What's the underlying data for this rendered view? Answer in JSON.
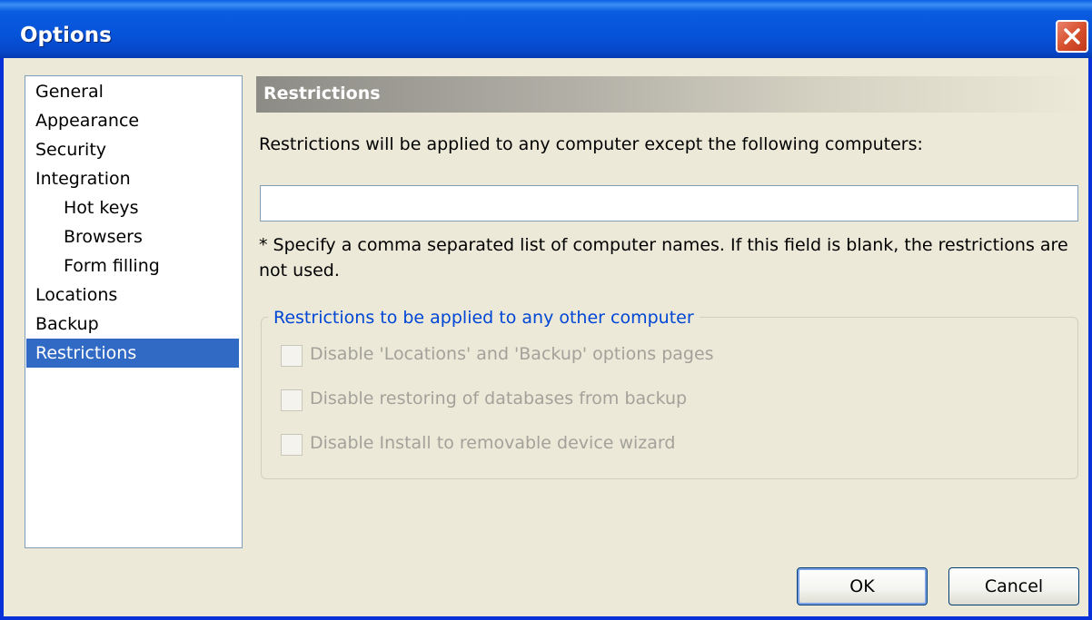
{
  "window": {
    "title": "Options"
  },
  "nav": {
    "items": [
      {
        "label": "General",
        "sub": false,
        "selected": false
      },
      {
        "label": "Appearance",
        "sub": false,
        "selected": false
      },
      {
        "label": "Security",
        "sub": false,
        "selected": false
      },
      {
        "label": "Integration",
        "sub": false,
        "selected": false
      },
      {
        "label": "Hot keys",
        "sub": true,
        "selected": false
      },
      {
        "label": "Browsers",
        "sub": true,
        "selected": false
      },
      {
        "label": "Form filling",
        "sub": true,
        "selected": false
      },
      {
        "label": "Locations",
        "sub": false,
        "selected": false
      },
      {
        "label": "Backup",
        "sub": false,
        "selected": false
      },
      {
        "label": "Restrictions",
        "sub": false,
        "selected": true
      }
    ]
  },
  "page": {
    "header": "Restrictions",
    "description": "Restrictions will be applied to any computer except the following computers:",
    "computers_input": {
      "value": "",
      "placeholder": ""
    },
    "note": "* Specify a comma separated list of computer names. If this field is blank, the restrictions are not used.",
    "group": {
      "legend": "Restrictions to be applied to any other computer",
      "options": [
        {
          "label": "Disable 'Locations' and 'Backup' options pages",
          "checked": false,
          "enabled": false
        },
        {
          "label": "Disable restoring of databases from backup",
          "checked": false,
          "enabled": false
        },
        {
          "label": "Disable Install to removable device wizard",
          "checked": false,
          "enabled": false
        }
      ]
    }
  },
  "buttons": {
    "ok": "OK",
    "cancel": "Cancel"
  },
  "colors": {
    "titlebar": "#0a5ce0",
    "selection": "#316ac5",
    "legend": "#0046d5",
    "disabled_text": "#a3a29a"
  }
}
